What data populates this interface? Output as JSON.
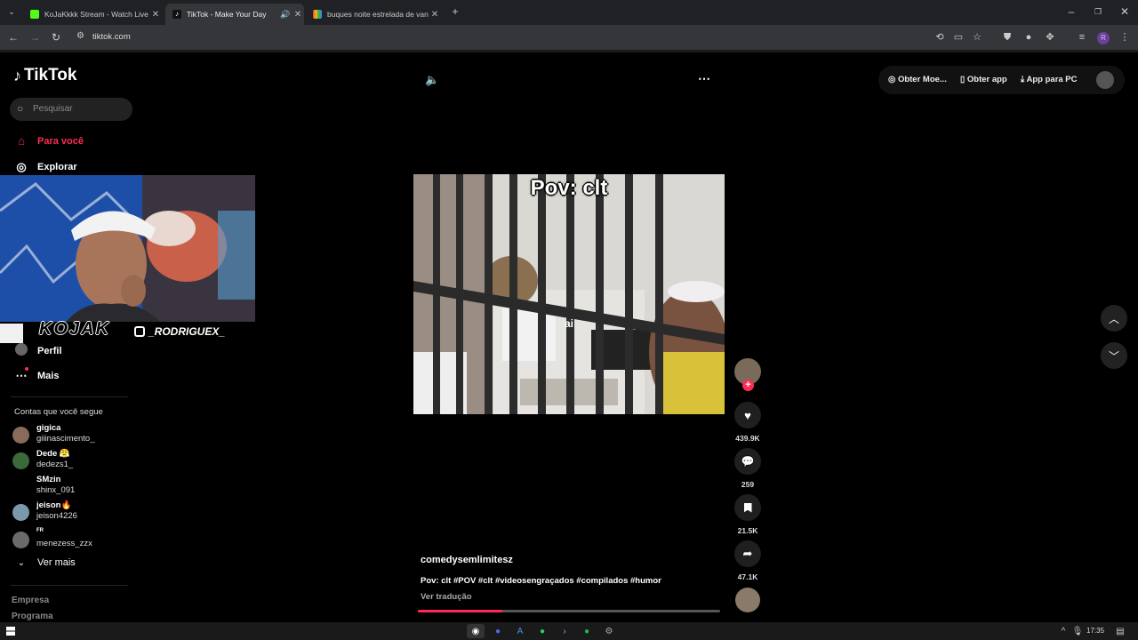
{
  "browser": {
    "tabs": [
      {
        "title": "KoJaKkkk Stream - Watch Live o",
        "active": false,
        "favicon_color": "#53fc18"
      },
      {
        "title": "TikTok - Make Your Day",
        "active": true,
        "favicon_color": "#000000"
      },
      {
        "title": "buques noite estrelada de van",
        "active": false,
        "favicon_color": "#4285f4"
      }
    ],
    "url": "tiktok.com"
  },
  "sidebar": {
    "logo_text": "TikTok",
    "search_placeholder": "Pesquisar",
    "nav": [
      {
        "label": "Para você",
        "icon": "home-icon",
        "active": true
      },
      {
        "label": "Explorar",
        "icon": "compass-icon",
        "active": false
      },
      {
        "label": "Perfil",
        "icon": "profile-icon",
        "active": false
      },
      {
        "label": "Mais",
        "icon": "more-icon",
        "active": false
      }
    ],
    "following_title": "Contas que você segue",
    "following": [
      {
        "name": "gigica",
        "user": "giiinascimento_",
        "avatar_color": "#8a6a5a"
      },
      {
        "name": "Dede 😤",
        "user": "dedezs1_",
        "avatar_color": "#3a6a3a"
      },
      {
        "name": "SMzin",
        "user": "shinx_091",
        "avatar_color": "#000000"
      },
      {
        "name": "jeison🔥",
        "user": "jeison4226",
        "avatar_color": "#7a9aaa"
      },
      {
        "name": "FR",
        "user": "menezess_zzx",
        "avatar_color": "#6a6a6a"
      }
    ],
    "see_more": "Ver mais",
    "footer_links": [
      "Empresa",
      "Programa"
    ]
  },
  "stream_overlay": {
    "logo_text": "KOJAK",
    "handle": "_RODRIGUEX_"
  },
  "top_right": {
    "coins": "Obter Moe...",
    "get_app": "Obter app",
    "pc_app": "App para PC"
  },
  "video": {
    "caption": "Pov: clt",
    "subtitle": "ai",
    "author": "comedysemlimitesz",
    "description": "Pov: clt #POV #clt #videosengraçados #compilados #humor",
    "translate": "Ver tradução",
    "progress": 0.28
  },
  "actions": {
    "likes": "439.9K",
    "comments": "259",
    "saves": "21.5K",
    "shares": "47.1K"
  },
  "taskbar": {
    "time": "17:35"
  },
  "colors": {
    "accent": "#fe2c55",
    "background": "#000000"
  }
}
